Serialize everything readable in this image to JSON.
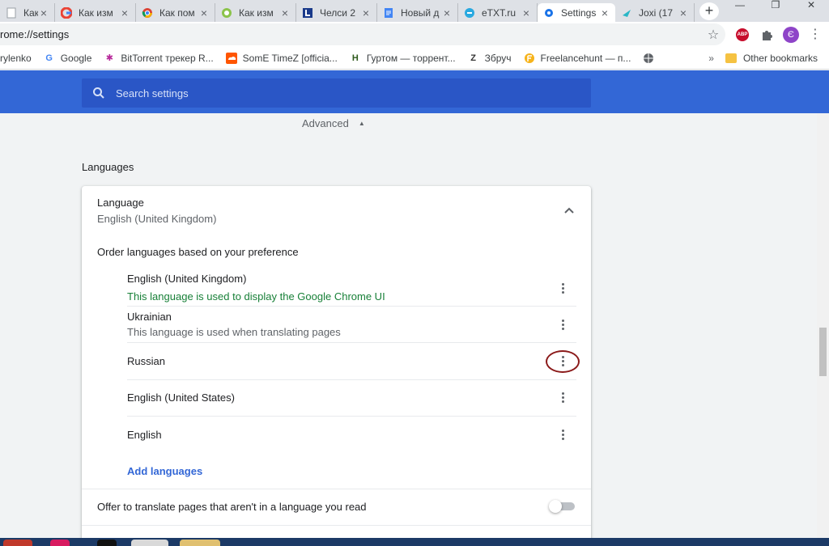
{
  "tabs": [
    {
      "title": "Как изм",
      "icon": "page-icon"
    },
    {
      "title": "Как изм",
      "icon": "google-icon"
    },
    {
      "title": "Как пом",
      "icon": "chrome-icon"
    },
    {
      "title": "Как изм",
      "icon": "green-circle-icon"
    },
    {
      "title": "Челси 2",
      "icon": "l-logo-icon"
    },
    {
      "title": "Новый д",
      "icon": "docs-icon"
    },
    {
      "title": "eTXT.ru",
      "icon": "etxt-icon"
    },
    {
      "title": "Settings",
      "icon": "gear-icon",
      "active": true
    },
    {
      "title": "Joxi (17",
      "icon": "joxi-icon"
    }
  ],
  "window": {
    "minimize": "—",
    "restore": "❐",
    "close": "✕"
  },
  "omnibox": {
    "url": "rome://settings"
  },
  "bookmarks": [
    {
      "label": "rylenko",
      "icon": ""
    },
    {
      "label": "Google",
      "icon": "google-icon"
    },
    {
      "label": "BitTorrent трекер R...",
      "icon": "bittorrent-icon"
    },
    {
      "label": "SomE TimeZ [officia...",
      "icon": "soundcloud-icon"
    },
    {
      "label": "Гуртом — торрент...",
      "icon": "h-icon"
    },
    {
      "label": "Збруч",
      "icon": "z-icon"
    },
    {
      "label": "Freelancehunt — п...",
      "icon": "freelancehunt-icon"
    },
    {
      "label": "",
      "icon": "globe-icon"
    }
  ],
  "other_bookmarks": "Other bookmarks",
  "avatar_letter": "Є",
  "abp_label": "ABP",
  "search": {
    "placeholder": "Search settings"
  },
  "advanced_label": "Advanced",
  "section_title": "Languages",
  "language": {
    "label": "Language",
    "value": "English (United Kingdom)",
    "order_label": "Order languages based on your preference",
    "items": [
      {
        "name": "English (United Kingdom)",
        "sub": "This language is used to display the Google Chrome UI"
      },
      {
        "name": "Ukrainian",
        "sub": "This language is used when translating pages"
      },
      {
        "name": "Russian",
        "sub": ""
      },
      {
        "name": "English (United States)",
        "sub": ""
      },
      {
        "name": "English",
        "sub": ""
      }
    ],
    "add_label": "Add languages",
    "offer_translate": "Offer to translate pages that aren't in a language you read",
    "offer_enabled": false
  },
  "colors": {
    "header": "#3367d6",
    "accent_green": "#188038",
    "link": "#3367d6",
    "highlight_ring": "#8b1a1a"
  }
}
